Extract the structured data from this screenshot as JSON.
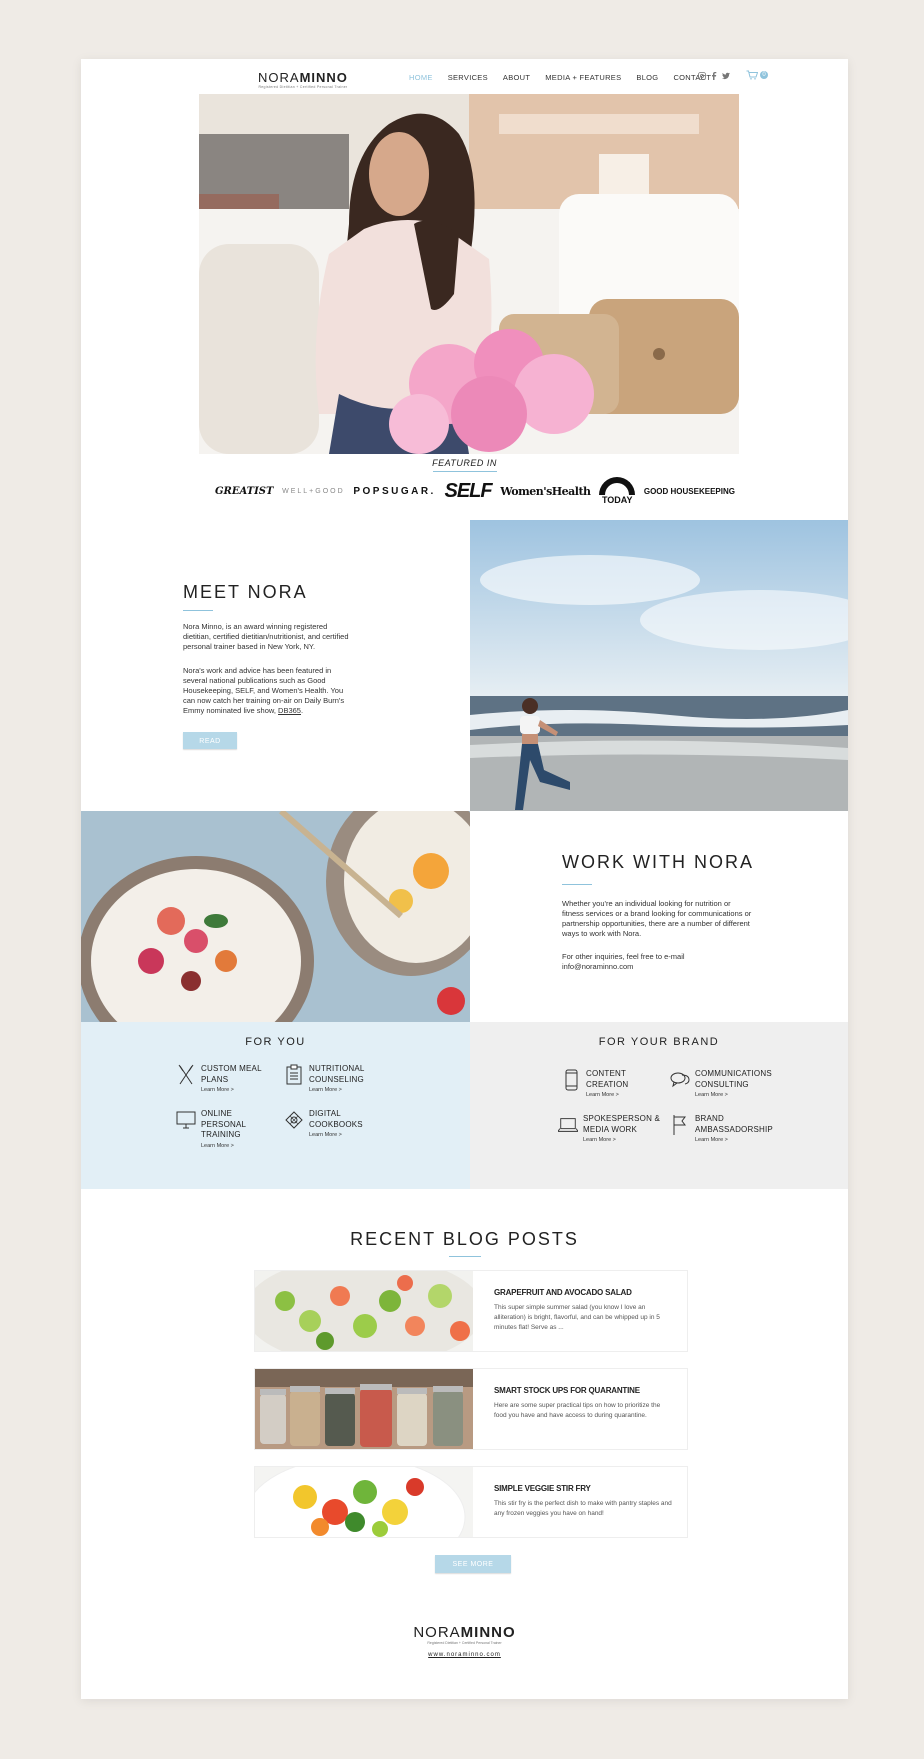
{
  "header": {
    "logo_name_light": "NORA",
    "logo_name_bold": "MINNO",
    "logo_tagline": "Registered Dietitian + Certified Personal Trainer",
    "nav": [
      "HOME",
      "SERVICES",
      "ABOUT",
      "MEDIA + FEATURES",
      "BLOG",
      "CONTACT"
    ],
    "active_nav": "HOME",
    "social_icons": [
      "instagram-icon",
      "facebook-icon",
      "twitter-icon"
    ],
    "cart_count": "0"
  },
  "featured": {
    "title": "FEATURED IN",
    "outlets": [
      "GREATIST",
      "WELL+GOOD",
      "POPSUGAR.",
      "SELF",
      "Women'sHealth",
      "TODAY",
      "GOOD HOUSEKEEPING"
    ]
  },
  "meet": {
    "title": "MEET NORA",
    "p1": "Nora Minno, is an award winning registered dietitian, certified dietitian/nutritionist, and certified personal trainer based in New York, NY.",
    "p2": "Nora's work and advice has been featured in several national publications such as Good Housekeeping, SELF, and Women's Health. You can now catch her training on-air on Daily Burn's Emmy nominated live show, ",
    "p2_link": "DB365",
    "p2_end": ".",
    "button": "READ MORE"
  },
  "work": {
    "title": "WORK WITH NORA",
    "p1": "Whether you're an individual looking for nutrition or fitness services or a brand looking for communications or partnership opportunities, there are a number of different ways to work with Nora.",
    "p2": "For other inquiries, feel free to e-mail info@noraminno.com"
  },
  "for_you": {
    "title": "FOR YOU",
    "services": [
      {
        "label": "CUSTOM MEAL PLANS",
        "link": "Learn More >",
        "icon": "utensils-icon"
      },
      {
        "label": "NUTRITIONAL COUNSELING",
        "link": "Learn More >",
        "icon": "clipboard-icon"
      },
      {
        "label": "ONLINE PERSONAL TRAINING",
        "link": "Learn More >",
        "icon": "monitor-icon"
      },
      {
        "label": "DIGITAL COOKBOOKS",
        "link": "Learn More >",
        "icon": "cookbook-icon"
      }
    ]
  },
  "for_brand": {
    "title": "FOR YOUR BRAND",
    "services": [
      {
        "label": "CONTENT CREATION",
        "link": "Learn More >",
        "icon": "phone-icon"
      },
      {
        "label": "COMMUNICATIONS CONSULTING",
        "link": "Learn More >",
        "icon": "chat-icon"
      },
      {
        "label": "SPOKESPERSON & MEDIA WORK",
        "link": "Learn More >",
        "icon": "laptop-icon"
      },
      {
        "label": "BRAND AMBASSADORSHIP",
        "link": "Learn More >",
        "icon": "flag-icon"
      }
    ]
  },
  "blog": {
    "title": "RECENT BLOG POSTS",
    "posts": [
      {
        "title": "GRAPEFRUIT AND AVOCADO SALAD",
        "excerpt": "This super simple summer salad (you know I love an alliteration) is bright, flavorful, and can be whipped up in 5 minutes flat! Serve as ..."
      },
      {
        "title": "SMART STOCK UPS FOR QUARANTINE",
        "excerpt": "Here are some super practical tips on how to prioritize the food you have and have access to during quarantine."
      },
      {
        "title": "SIMPLE VEGGIE STIR FRY",
        "excerpt": "This stir fry is the perfect dish to make with pantry staples and any frozen veggies you have on hand!"
      }
    ],
    "see_more": "SEE MORE"
  },
  "footer": {
    "logo_name_light": "NORA",
    "logo_name_bold": "MINNO",
    "tagline": "Registered Dietitian + Certified Personal Trainer",
    "url": "www.noraminno.com"
  }
}
